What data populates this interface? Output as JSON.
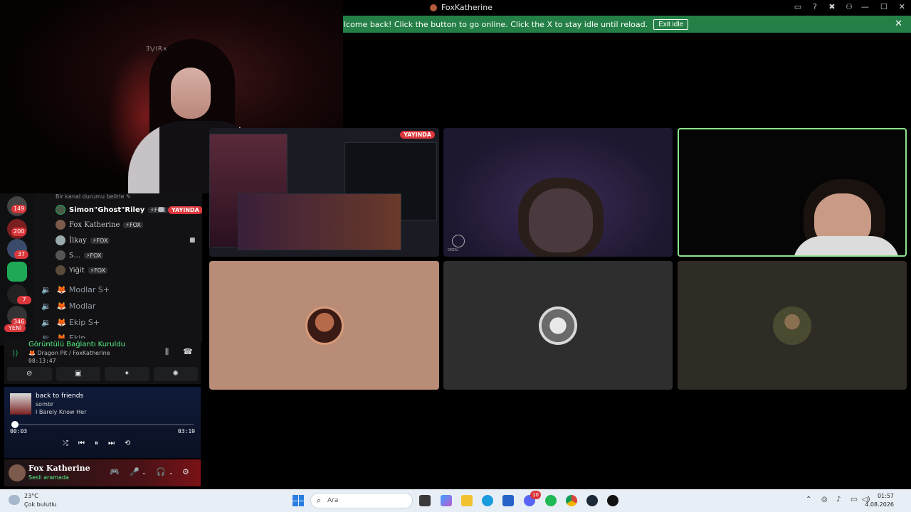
{
  "window": {
    "title": "FoxKatherine",
    "icons": [
      "inbox-icon",
      "help-icon",
      "tools-icon",
      "group-icon"
    ],
    "controls": [
      "minimize",
      "maximize",
      "close"
    ]
  },
  "banner": {
    "text": "lcome back! Click the button to go online. Click the X to stay idle until reload.",
    "button_label": "Exit idle",
    "close_glyph": "✕",
    "color": "#248046"
  },
  "server_badges": [
    "149",
    "200",
    "37",
    "7",
    "346"
  ],
  "server_new_label": "YENİ",
  "channel": {
    "status_placeholder": "Bir kanal durumu belirle ✎",
    "members": [
      {
        "name": "Simon\"Ghost\"Riley",
        "tag": "⚡FOX",
        "live": "YAYINDA"
      },
      {
        "name": "Fox Katherine",
        "tag": "⚡FOX"
      },
      {
        "name": "İlkay",
        "tag": "⚡FOX"
      },
      {
        "name": "S...",
        "tag": "⚡FOX"
      },
      {
        "name": "Yiğit",
        "tag": "⚡FOX"
      }
    ],
    "voice_channels": [
      "🦊 Modlar S+",
      "🦊 Modlar",
      "🦊 Ekip S+",
      "🦊 Ekip"
    ]
  },
  "voice_panel": {
    "title": "Görüntülü Bağlantı Kuruldu",
    "subtitle": "🦊 Dragon Pit / FoxKatherine",
    "elapsed": "08:13:47"
  },
  "music": {
    "track": "back to friends",
    "artist": "sombr",
    "album": "I Barely Know Her",
    "elapsed": "00:03",
    "duration": "03:19",
    "progress": 0.015
  },
  "user": {
    "name": "Fox Katherine",
    "status": "Sesli aramada"
  },
  "grid": {
    "live_label": "YAYINDA",
    "corner_label": "ORDU"
  },
  "taskbar": {
    "temperature": "23°C",
    "weather": "Çok bulutlu",
    "search_placeholder": "Ara",
    "time": "01:57",
    "date": "4.08.2026",
    "discord_badge": "10"
  }
}
